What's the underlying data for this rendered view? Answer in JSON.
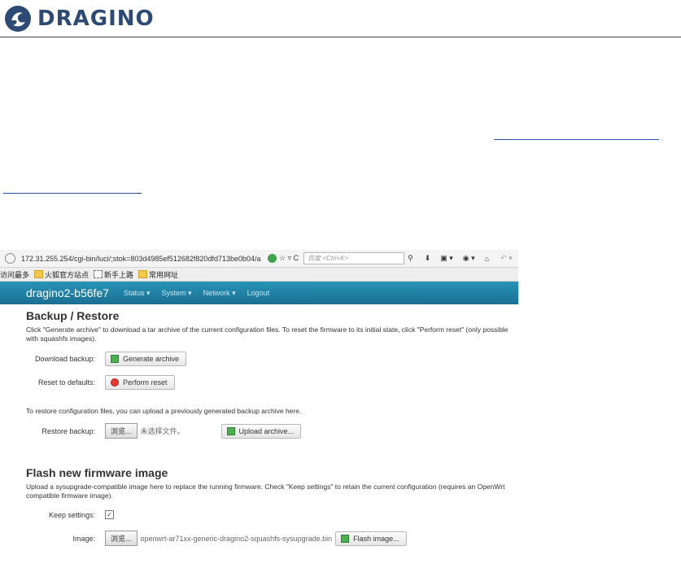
{
  "header": {
    "logo_text": "DRAGINO",
    "brand_color": "#2c4a73"
  },
  "browser": {
    "url": "172.31.255.254/cgi-bin/luci/;stok=803d4985ef512682f820dfd713be0b04/a",
    "search_placeholder": "百度 <Ctrl+K>",
    "bookmarks": [
      {
        "label": "访问最多"
      },
      {
        "label": "火狐官方站点"
      },
      {
        "label": "新手上路"
      },
      {
        "label": "常用网址"
      }
    ]
  },
  "luci": {
    "brand": "dragino2-b56fe7",
    "menu": [
      {
        "label": "Status ▾"
      },
      {
        "label": "System ▾"
      },
      {
        "label": "Network ▾"
      },
      {
        "label": "Logout"
      }
    ],
    "nav_color": "#1f80a6",
    "backup": {
      "title": "Backup / Restore",
      "desc": "Click \"Generate archive\" to download a tar archive of the current configuration files. To reset the firmware to its initial state, click \"Perform reset\" (only possible with squashfs images).",
      "download_label": "Download backup:",
      "generate_btn": "Generate archive",
      "reset_label": "Reset to defaults:",
      "reset_btn": "Perform reset",
      "restore_desc": "To restore configuration files, you can upload a previously generated backup archive here.",
      "restore_label": "Restore backup:",
      "browse_btn": "浏览...",
      "no_file": "未选择文件。",
      "upload_btn": "Upload archive..."
    },
    "flash": {
      "title": "Flash new firmware image",
      "desc": "Upload a sysupgrade-compatible image here to replace the running firmware. Check \"Keep settings\" to retain the current configuration (requires an OpenWrt compatible firmware image).",
      "keep_label": "Keep settings:",
      "keep_checked": "✓",
      "image_label": "Image:",
      "browse_btn": "浏览...",
      "file_name": "openwrt-ar71xx-generic-dragino2-squashfs-sysupgrade.bin",
      "flash_btn": "Flash image..."
    }
  }
}
